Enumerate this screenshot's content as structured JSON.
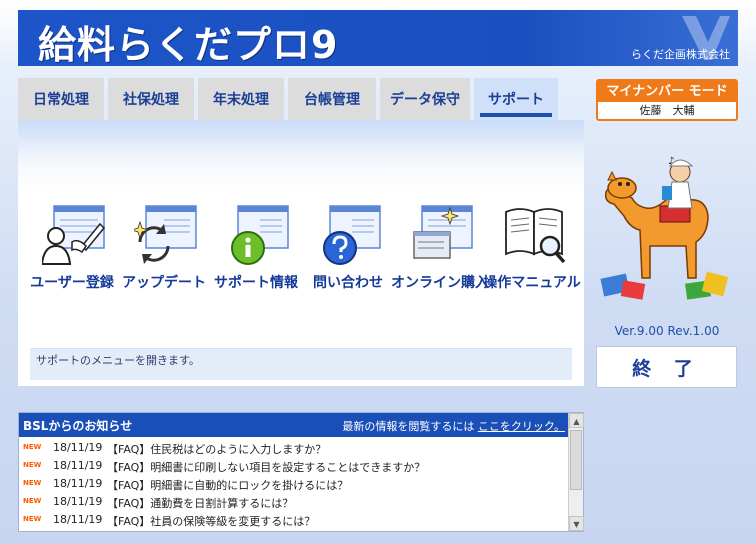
{
  "header": {
    "app_title": "給料らくだプロ9",
    "company": "らくだ企画株式会社"
  },
  "tabs": [
    {
      "label": "日常処理",
      "active": false
    },
    {
      "label": "社保処理",
      "active": false
    },
    {
      "label": "年末処理",
      "active": false
    },
    {
      "label": "台帳管理",
      "active": false
    },
    {
      "label": "データ保守",
      "active": false
    },
    {
      "label": "サポート",
      "active": true
    }
  ],
  "menu": [
    {
      "label": "ユーザー登録",
      "icon": "user-registration-icon"
    },
    {
      "label": "アップデート",
      "icon": "update-icon"
    },
    {
      "label": "サポート情報",
      "icon": "info-icon"
    },
    {
      "label": "問い合わせ",
      "icon": "question-icon"
    },
    {
      "label": "オンライン購入",
      "icon": "online-purchase-icon"
    },
    {
      "label": "操作マニュアル",
      "icon": "manual-icon"
    }
  ],
  "status": {
    "text": "サポートのメニューを開きます。"
  },
  "mynumber": {
    "title": "マイナンバー モード",
    "user": "佐藤　大輔"
  },
  "version": "Ver.9.00 Rev.1.00",
  "exit_button": {
    "label": "終 了"
  },
  "news": {
    "title": "BSLからのお知らせ",
    "prompt": "最新の情報を閲覧するには",
    "link_label": "ここをクリック。",
    "new_badge": "NEW",
    "items": [
      {
        "date": "18/11/19",
        "text": "【FAQ】住民税はどのように入力しますか？"
      },
      {
        "date": "18/11/19",
        "text": "【FAQ】明細書に印刷しない項目を設定することはできますか？"
      },
      {
        "date": "18/11/19",
        "text": "【FAQ】明細書に自動的にロックを掛けるには？"
      },
      {
        "date": "18/11/19",
        "text": "【FAQ】通勤費を日割計算するには？"
      },
      {
        "date": "18/11/19",
        "text": "【FAQ】社員の保険等級を変更するには？"
      }
    ]
  },
  "colors": {
    "header_blue": "#1d55c8",
    "tab_text": "#1b3f96",
    "accent_orange": "#f07a1a",
    "new_badge": "#ff5a00"
  }
}
